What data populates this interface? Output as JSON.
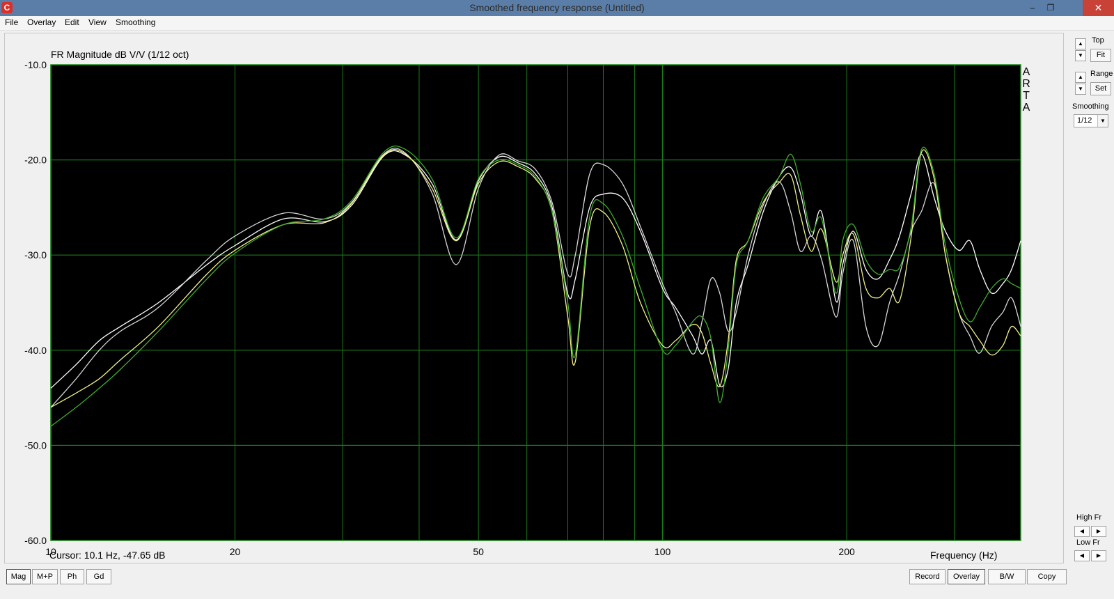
{
  "window": {
    "title": "Smoothed frequency response (Untitled)",
    "app_icon": "C"
  },
  "menu": [
    "File",
    "Overlay",
    "Edit",
    "View",
    "Smoothing"
  ],
  "plot": {
    "title": "FR Magnitude dB V/V (1/12 oct)",
    "watermark": [
      "A",
      "R",
      "T",
      "A"
    ],
    "cursor": "Cursor: 10.1 Hz, -47.65 dB",
    "xlabel": "Frequency (Hz)"
  },
  "right_panel": {
    "top_label": "Top",
    "fit_label": "Fit",
    "range_label": "Range",
    "set_label": "Set",
    "smoothing_label": "Smoothing",
    "smoothing_value": "1/12",
    "high_fr_label": "High Fr",
    "low_fr_label": "Low Fr"
  },
  "bottom_left_buttons": [
    "Mag",
    "M+P",
    "Ph",
    "Gd"
  ],
  "bottom_right_buttons": [
    "Record",
    "Overlay",
    "B/W",
    "Copy"
  ],
  "colors": {
    "plot_bg": "#000000",
    "grid": "#1a7a1a",
    "title_bar": "#5b7ea8",
    "close_button": "#c94238"
  },
  "chart_data": {
    "type": "line",
    "title": "FR Magnitude dB V/V (1/12 oct)",
    "xlabel": "Frequency (Hz)",
    "ylabel": "",
    "x_scale": "log",
    "xlim": [
      10,
      385
    ],
    "ylim": [
      -60,
      -10
    ],
    "grid": true,
    "ytick_labels": [
      "-10.0",
      "-20.0",
      "-30.0",
      "-40.0",
      "-50.0",
      "-60.0"
    ],
    "xtick_labels": [
      "10",
      "20",
      "50",
      "100",
      "200"
    ],
    "series": [
      {
        "color": "#ffffff",
        "x": [
          10,
          11,
          12,
          13,
          15,
          18,
          20,
          24,
          28,
          31,
          35,
          38,
          42,
          46,
          50,
          54,
          58,
          62,
          66,
          70,
          72,
          76,
          80,
          86,
          92,
          100,
          105,
          112,
          116,
          120,
          124,
          128,
          132,
          138,
          146,
          155,
          162,
          168,
          175,
          182,
          192,
          197,
          205,
          215,
          225,
          235,
          244,
          255,
          265,
          278,
          290,
          305,
          318,
          330,
          345,
          360,
          372,
          385
        ],
        "y": [
          -44,
          -41.5,
          -39,
          -37.5,
          -35,
          -31,
          -29,
          -26.2,
          -26.5,
          -24.8,
          -19.6,
          -19.5,
          -22.5,
          -28.4,
          -22.2,
          -19.7,
          -20.3,
          -21.5,
          -25,
          -34.1,
          -32.5,
          -25,
          -23.6,
          -24,
          -27.5,
          -33.5,
          -35.5,
          -38.5,
          -40.4,
          -39,
          -43.7,
          -42,
          -35,
          -31,
          -25.5,
          -21.8,
          -20.8,
          -23.5,
          -28,
          -25.5,
          -34.8,
          -31,
          -27.5,
          -31.5,
          -32.5,
          -30.5,
          -28,
          -23.5,
          -19.4,
          -24,
          -27.5,
          -29.5,
          -28.5,
          -31.5,
          -34,
          -33,
          -31.5,
          -28.5
        ]
      },
      {
        "color": "#d6d6d6",
        "x": [
          10,
          11,
          12,
          13,
          15,
          18,
          20,
          24,
          28,
          31,
          35,
          38,
          42,
          46,
          50,
          54,
          58,
          62,
          66,
          70,
          72,
          76,
          80,
          86,
          92,
          100,
          105,
          112,
          116,
          120,
          124,
          128,
          132,
          138,
          146,
          155,
          162,
          168,
          175,
          182,
          192,
          197,
          205,
          215,
          225,
          235,
          244,
          255,
          265,
          278,
          290,
          305,
          318,
          330,
          345,
          360,
          372,
          385
        ],
        "y": [
          -46,
          -43,
          -40,
          -38,
          -35.5,
          -30.5,
          -28,
          -25.6,
          -26.2,
          -24.5,
          -19.4,
          -19.3,
          -23.5,
          -31,
          -23,
          -19.5,
          -20.1,
          -21,
          -24.5,
          -32,
          -30,
          -21.5,
          -20.5,
          -22.5,
          -27,
          -33,
          -36,
          -40.4,
          -37,
          -32.5,
          -34,
          -38,
          -36,
          -30,
          -24.8,
          -22.3,
          -25.5,
          -29.6,
          -28,
          -30.5,
          -36.5,
          -32,
          -28.5,
          -37.5,
          -39.5,
          -35,
          -32,
          -27.5,
          -25.4,
          -22.5,
          -30,
          -36,
          -38.5,
          -40.3,
          -37.5,
          -36,
          -34.5,
          -37.5
        ]
      },
      {
        "color": "#f0f088",
        "x": [
          10,
          11,
          12,
          13,
          15,
          18,
          20,
          24,
          28,
          31,
          35,
          38,
          42,
          46,
          50,
          54,
          58,
          62,
          66,
          70,
          72,
          76,
          80,
          86,
          92,
          100,
          105,
          112,
          116,
          120,
          124,
          128,
          132,
          138,
          146,
          155,
          162,
          168,
          175,
          182,
          192,
          197,
          205,
          215,
          225,
          235,
          244,
          255,
          265,
          278,
          290,
          305,
          318,
          330,
          345,
          360,
          372,
          385
        ],
        "y": [
          -46,
          -44.5,
          -43,
          -41,
          -37.5,
          -32,
          -29.5,
          -26.8,
          -26.6,
          -24.6,
          -19.5,
          -19.4,
          -23,
          -28.5,
          -22.5,
          -20.2,
          -20.7,
          -22,
          -25.5,
          -36.5,
          -41.2,
          -27,
          -25.5,
          -29,
          -35,
          -39.5,
          -39,
          -37.3,
          -38.2,
          -41.5,
          -43.8,
          -39,
          -30.5,
          -28.5,
          -24.5,
          -22.4,
          -21.6,
          -25.8,
          -29.6,
          -27.3,
          -32.8,
          -30,
          -27.8,
          -33.5,
          -34.5,
          -33.5,
          -34.8,
          -28,
          -19.2,
          -22,
          -30,
          -36,
          -37.5,
          -39,
          -40.5,
          -39.5,
          -37.5,
          -38.5
        ]
      },
      {
        "color": "#3fae2b",
        "x": [
          10,
          11,
          12,
          13,
          15,
          18,
          20,
          24,
          28,
          31,
          35,
          38,
          42,
          46,
          50,
          54,
          58,
          62,
          66,
          70,
          72,
          76,
          80,
          86,
          92,
          100,
          105,
          112,
          116,
          120,
          124,
          128,
          132,
          138,
          146,
          155,
          162,
          168,
          175,
          182,
          192,
          197,
          205,
          215,
          225,
          235,
          244,
          255,
          265,
          278,
          290,
          305,
          318,
          330,
          345,
          360,
          372,
          385
        ],
        "y": [
          -48,
          -46,
          -44,
          -42,
          -38,
          -32.5,
          -29.8,
          -26.8,
          -26.2,
          -24.3,
          -19.2,
          -18.9,
          -22,
          -28.2,
          -22,
          -20,
          -20.5,
          -21.8,
          -25.5,
          -35,
          -40.5,
          -26,
          -24.6,
          -28,
          -33.5,
          -40,
          -39.5,
          -37,
          -36.5,
          -38.8,
          -45.5,
          -40,
          -31,
          -28.5,
          -24,
          -21.8,
          -19.4,
          -22.5,
          -27.5,
          -26.2,
          -34,
          -28.5,
          -26.8,
          -30.5,
          -32,
          -31.5,
          -31.3,
          -27,
          -18.9,
          -21.5,
          -29,
          -34.5,
          -37,
          -35.5,
          -33.5,
          -32.5,
          -33,
          -33.5
        ]
      }
    ]
  }
}
